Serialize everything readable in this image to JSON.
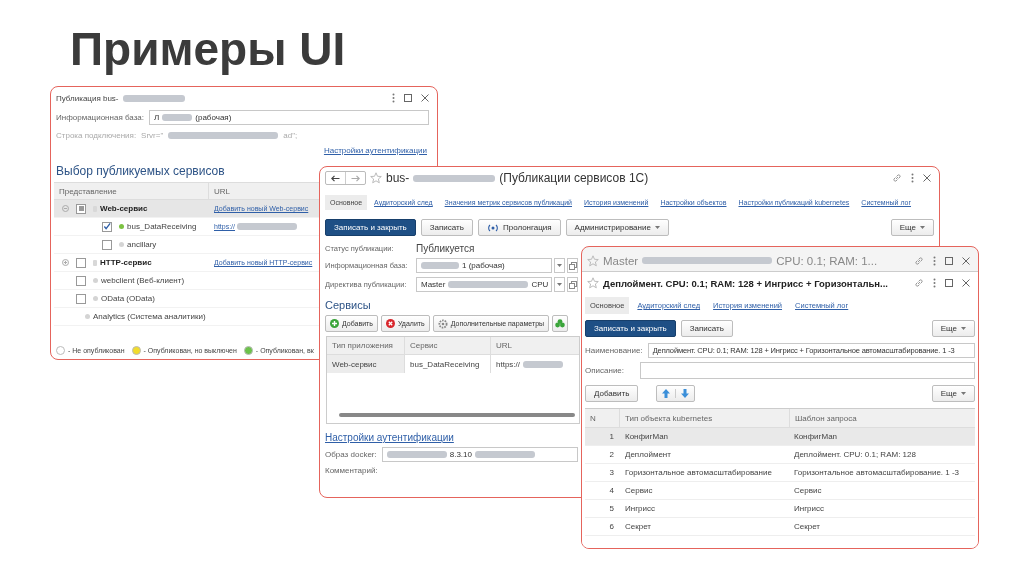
{
  "slide_title": "Примеры UI",
  "publication_window": {
    "title": [
      {
        "kind": "text",
        "text": "Публикация bus-"
      },
      {
        "kind": "blur"
      }
    ],
    "infobase": {
      "label": "Информационная база:",
      "value": [
        {
          "kind": "text",
          "text": "Л"
        },
        {
          "kind": "blur"
        },
        {
          "kind": "text",
          "text": "(рабочая)"
        }
      ]
    },
    "connection": {
      "label": "Строка подключения:",
      "value": [
        {
          "kind": "text",
          "text": "Srvr=\""
        },
        {
          "kind": "blur"
        },
        {
          "kind": "text",
          "text": "ad\";"
        }
      ],
      "disabled": true
    },
    "auth_link": "Настройки аутентификации",
    "heading": "Выбор публикуемых сервисов",
    "columns": [
      "Представление",
      "URL"
    ],
    "tree": [
      {
        "label": "Web-сервис",
        "kind": "group",
        "expanded": true,
        "partial": true,
        "selected": true,
        "url": [
          {
            "kind": "text",
            "text": "Добавить новый Web-сервис"
          }
        ],
        "children": [
          {
            "label": "bus_DataReceiving",
            "kind": "service",
            "checked": true,
            "selected": false,
            "color": "#7cc242",
            "url": [
              {
                "kind": "text",
                "text": "https://"
              },
              {
                "kind": "blur"
              }
            ]
          },
          {
            "label": "ancillary",
            "kind": "service",
            "checked": false,
            "selected": false,
            "color": "#d4d4d4"
          }
        ]
      },
      {
        "label": "HTTP-сервис",
        "kind": "group",
        "expanded": false,
        "partial": false,
        "selected": false,
        "url": [
          {
            "kind": "text",
            "text": "Добавить новый HTTP-сервис"
          }
        ]
      },
      {
        "label": "webclient (Веб-клиент)",
        "kind": "service",
        "checked": false,
        "selected": false,
        "color": "#d4d4d4"
      },
      {
        "label": "OData (OData)",
        "kind": "service",
        "checked": false,
        "selected": false,
        "color": "#d4d4d4"
      },
      {
        "label": "Analytics (Система аналитики)",
        "kind": "plain",
        "selected": false,
        "color": "#d4d4d4"
      }
    ],
    "legend": [
      {
        "text": "- Не опубликован",
        "color": "#ffffff"
      },
      {
        "text": "- Опубликован, но выключен",
        "color": "#f2dc2c"
      },
      {
        "text": "- Опубликован, вк",
        "color": "#6cc24a"
      }
    ]
  },
  "publications_window": {
    "title": [
      {
        "kind": "text",
        "text": "bus-"
      },
      {
        "kind": "blur"
      },
      {
        "kind": "text",
        "text": "(Публикации сервисов 1С)"
      }
    ],
    "tabs": [
      {
        "label": "Основное",
        "selected": true
      },
      {
        "label": "Аудиторский след",
        "selected": false
      },
      {
        "label": "Значения метрик сервисов публикаций",
        "selected": false
      },
      {
        "label": "История изменений",
        "selected": false
      },
      {
        "label": "Настройки объектов",
        "selected": false
      },
      {
        "label": "Настройки публикаций kubernetes",
        "selected": false
      },
      {
        "label": "Системный лог",
        "selected": false
      }
    ],
    "buttons": [
      {
        "label": "Записать и закрыть",
        "kind": "primary"
      },
      {
        "label": "Записать",
        "kind": "plain"
      },
      {
        "label": "Пролонгация",
        "kind": "broadcast"
      },
      {
        "label": "Администрирование",
        "kind": "dropdown"
      }
    ],
    "more_button": "Еще",
    "status": {
      "label": "Статус публикации:",
      "value": "Публикуется"
    },
    "fields": [
      {
        "label": "Информационная база:",
        "value": [
          {
            "kind": "blur"
          },
          {
            "kind": "text",
            "text": "1 (рабочая)"
          }
        ]
      },
      {
        "label": "Директива публикации:",
        "value": [
          {
            "kind": "text",
            "text": "Master"
          },
          {
            "kind": "blur"
          },
          {
            "kind": "text",
            "text": "CPU"
          }
        ]
      }
    ],
    "services_heading": "Сервисы",
    "service_buttons": [
      {
        "label": "Добавить",
        "kind": "add"
      },
      {
        "label": "Удалить",
        "kind": "delete"
      },
      {
        "label": "Дополнительные параметры",
        "kind": "settings"
      },
      {
        "kind": "extra"
      }
    ],
    "columns": [
      "Тип приложения",
      "Сервис",
      "URL"
    ],
    "rows": [
      {
        "type": "Web-сервис",
        "service": "bus_DataReceiving",
        "url": [
          {
            "kind": "text",
            "text": "https://"
          },
          {
            "kind": "blur"
          }
        ]
      }
    ],
    "auth_link": "Настройки аутентификации",
    "docker": {
      "label": "Образ docker:",
      "value": [
        {
          "kind": "blur"
        },
        {
          "kind": "text",
          "text": "8.3.10"
        },
        {
          "kind": "blur"
        }
      ]
    },
    "comment_label": "Комментарий:"
  },
  "deployment_window": {
    "back_title": [
      {
        "kind": "text",
        "text": "Master"
      },
      {
        "kind": "blur"
      },
      {
        "kind": "text",
        "text": "CPU: 0.1; RAM: 1..."
      }
    ],
    "title": "Деплоймент. CPU: 0.1; RAM: 128 + Ингрисс + Горизонтальн...",
    "tabs": [
      {
        "label": "Основное",
        "selected": true
      },
      {
        "label": "Аудиторский след",
        "selected": false
      },
      {
        "label": "История изменений",
        "selected": false
      },
      {
        "label": "Системный лог",
        "selected": false
      }
    ],
    "buttons": [
      {
        "label": "Записать и закрыть",
        "kind": "primary"
      },
      {
        "label": "Записать",
        "kind": "plain"
      }
    ],
    "more_button": "Еще",
    "name": {
      "label": "Наименование:",
      "value": "Деплоймент. CPU: 0.1; RAM: 128 + Ингрисс + Горизонтальное автомасштабирование. 1 -3"
    },
    "description": {
      "label": "Описание:"
    },
    "add_button": "Добавить",
    "table_more_button": "Еще",
    "columns": [
      "N",
      "Тип объекта kubernetes",
      "Шаблон запроса"
    ],
    "rows": [
      {
        "n": "1",
        "type": "КонфигMan",
        "template": "КонфигMan",
        "selected": true
      },
      {
        "n": "2",
        "type": "Деплоймент",
        "template": "Деплоймент. CPU: 0.1; RAM: 128",
        "selected": false
      },
      {
        "n": "3",
        "type": "Горизонтальное автомасштабирование",
        "template": "Горизонтальное автомасштабирование. 1 -3",
        "selected": false
      },
      {
        "n": "4",
        "type": "Сервис",
        "template": "Сервис",
        "selected": false
      },
      {
        "n": "5",
        "type": "Ингрисс",
        "template": "Ингрисс",
        "selected": false
      },
      {
        "n": "6",
        "type": "Секрет",
        "template": "Секрет",
        "selected": false
      }
    ]
  }
}
